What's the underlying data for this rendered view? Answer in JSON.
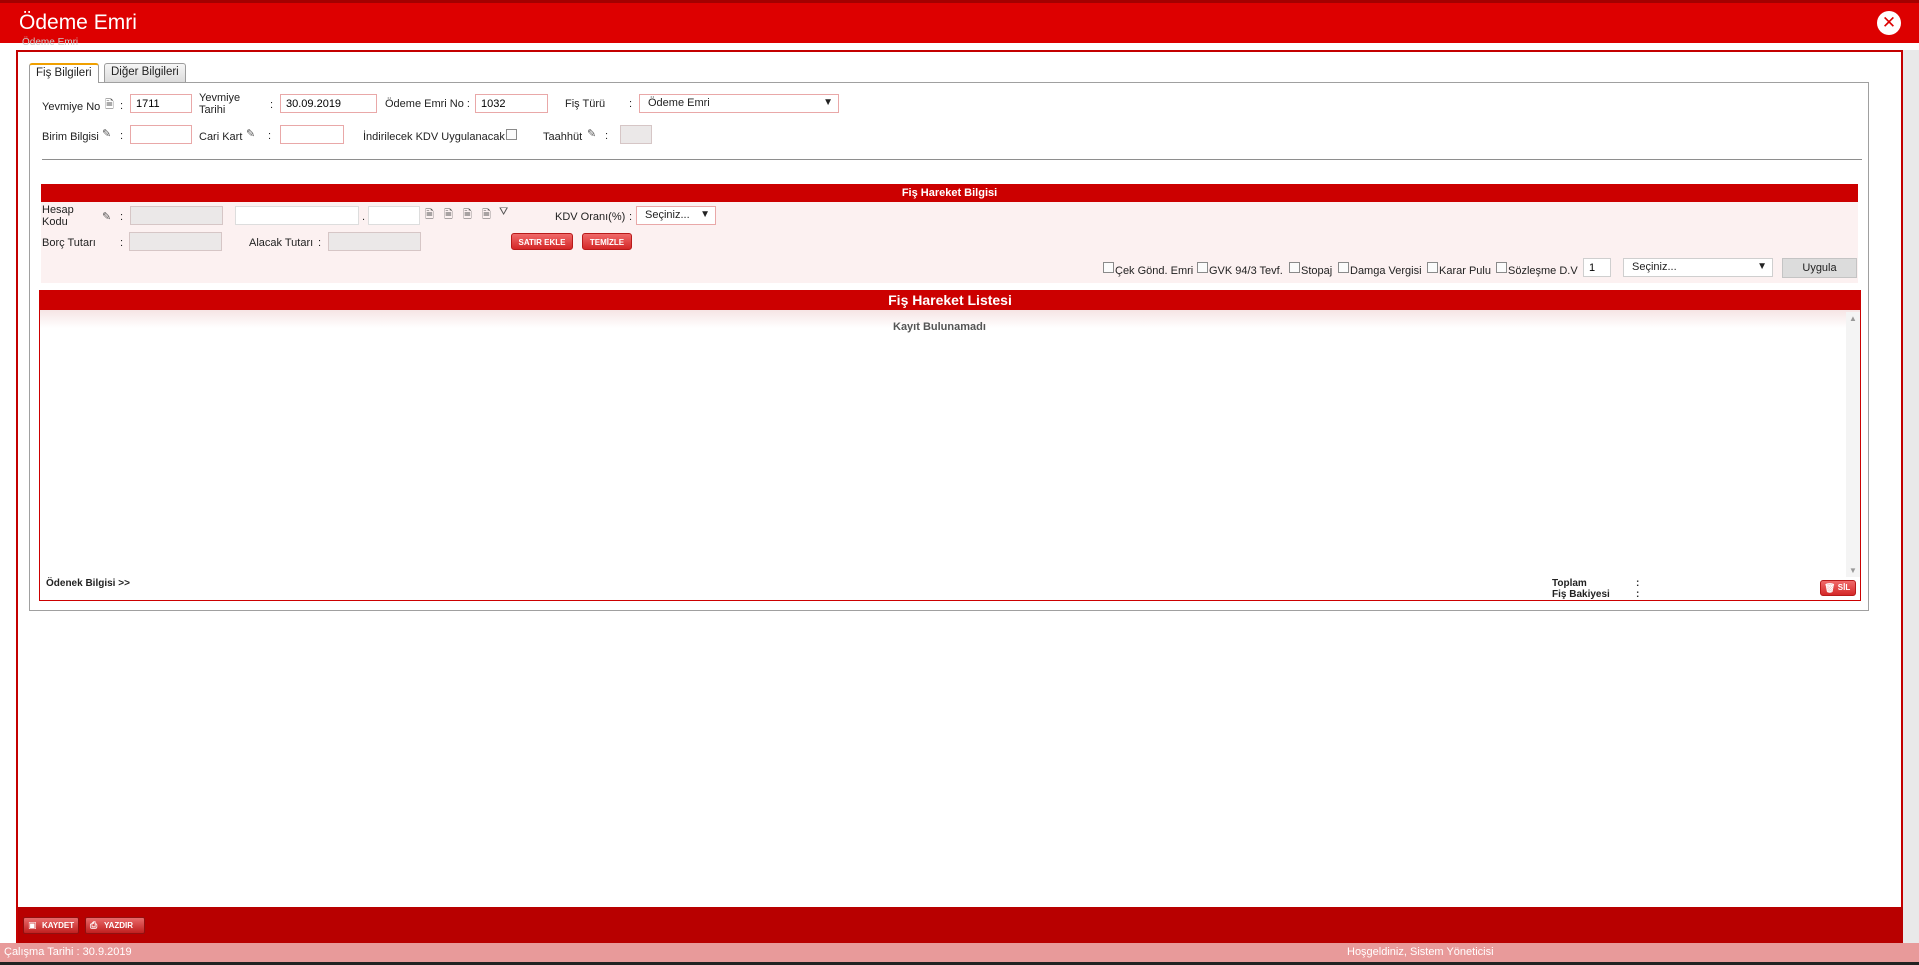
{
  "window": {
    "title": "Ödeme Emri",
    "breadcrumb": "Ödeme Emri"
  },
  "tabs": [
    {
      "label": "Fiş Bilgileri",
      "active": true
    },
    {
      "label": "Diğer Bilgileri",
      "active": false
    }
  ],
  "header_form": {
    "yevmiye_no_label": "Yevmiye No",
    "yevmiye_no_value": "1711",
    "yevmiye_tarihi_label_1": "Yevmiye",
    "yevmiye_tarihi_label_2": "Tarihi",
    "yevmiye_tarihi_value": "30.09.2019",
    "odeme_emri_no_label": "Ödeme Emri No :",
    "odeme_emri_no_value": "1032",
    "fis_turu_label": "Fiş Türü",
    "fis_turu_value": "Ödeme Emri",
    "birim_bilgisi_label": "Birim Bilgisi",
    "cari_kart_label": "Cari Kart",
    "indirilecek_kdv_label": "İndirilecek KDV Uygulanacak",
    "taahhut_label": "Taahhüt",
    "colon": ":"
  },
  "fis_hareket_bilgisi": {
    "title": "Fiş Hareket Bilgisi",
    "hesap_kodu_label_1": "Hesap",
    "hesap_kodu_label_2": "Kodu",
    "kdv_orani_label": "KDV Oranı(%)",
    "kdv_orani_value": "Seçiniz...",
    "borc_tutari_label": "Borç Tutarı",
    "alacak_tutari_label": "Alacak Tutarı",
    "satir_ekle": "SATIR EKLE",
    "temizle": "TEMİZLE",
    "dot": ".",
    "checkboxes": [
      "Çek Gönd. Emri",
      "GVK 94/3 Tevf.",
      "Stopaj",
      "Damga Vergisi",
      "Karar Pulu",
      "Sözleşme D.V"
    ],
    "count_value": "1",
    "secim_value": "Seçiniz...",
    "uygula": "Uygula"
  },
  "fis_hareket_listesi": {
    "title": "Fiş Hareket Listesi",
    "empty_message": "Kayıt Bulunamadı",
    "odenek_bilgisi": "Ödenek Bilgisi >>",
    "toplam_label": "Toplam",
    "fis_bakiyesi_label": "Fiş Bakiyesi",
    "sil": "SİL"
  },
  "footer": {
    "kaydet": "KAYDET",
    "yazdir": "YAZDIR",
    "calisma_tarihi": "Çalışma Tarihi : 30.9.2019",
    "hosgeldiniz": "Hoşgeldiniz, Sistem Yöneticisi"
  },
  "colors": {
    "primary_red": "#dd0000",
    "section_red": "#cc0000",
    "status_pink": "#e89a9a"
  },
  "icons": [
    "close-icon",
    "lookup-pencil-icon",
    "document-icon",
    "filter-icon",
    "trash-icon",
    "save-icon",
    "print-icon"
  ]
}
